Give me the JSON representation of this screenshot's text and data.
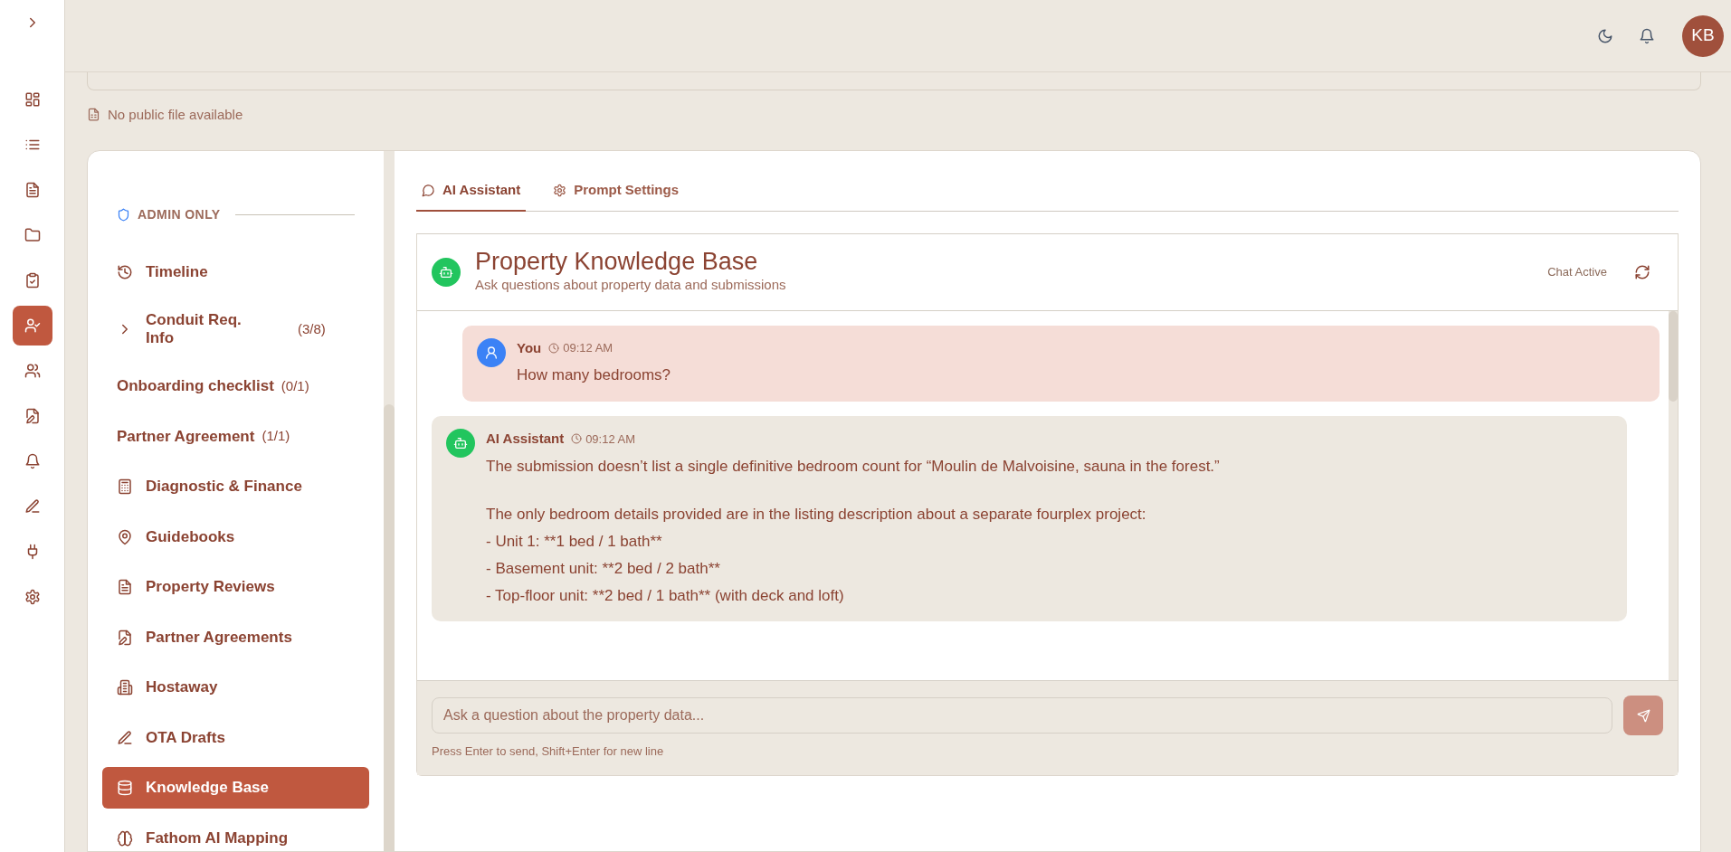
{
  "rail": {
    "items": [
      {
        "selected": false
      },
      {
        "selected": false
      },
      {
        "selected": false
      },
      {
        "selected": false
      },
      {
        "selected": false
      },
      {
        "selected": true
      },
      {
        "selected": false
      },
      {
        "selected": false
      },
      {
        "selected": false
      },
      {
        "selected": false
      },
      {
        "selected": false
      },
      {
        "selected": false
      }
    ]
  },
  "topbar": {
    "avatar": "KB"
  },
  "notice": "No public file available",
  "nav": {
    "section": "ADMIN ONLY",
    "items": [
      {
        "kind": "icon",
        "label": "Timeline",
        "selected": false
      },
      {
        "kind": "expander",
        "label": "Conduit Req. Info",
        "count": "(3/8)",
        "expanded": false,
        "selected": false
      },
      {
        "kind": "plain",
        "label": "Onboarding checklist",
        "count": "(0/1)",
        "selected": false
      },
      {
        "kind": "plain",
        "label": "Partner Agreement",
        "count": "(1/1)",
        "selected": false
      },
      {
        "kind": "icon",
        "label": "Diagnostic & Finance",
        "selected": false
      },
      {
        "kind": "icon",
        "label": "Guidebooks",
        "selected": false
      },
      {
        "kind": "icon",
        "label": "Property Reviews",
        "selected": false
      },
      {
        "kind": "icon",
        "label": "Partner Agreements",
        "selected": false
      },
      {
        "kind": "icon",
        "label": "Hostaway",
        "selected": false
      },
      {
        "kind": "icon",
        "label": "OTA Drafts",
        "selected": false
      },
      {
        "kind": "icon",
        "label": "Knowledge Base",
        "selected": true
      },
      {
        "kind": "icon",
        "label": "Fathom AI Mapping",
        "selected": false
      }
    ]
  },
  "tabs": [
    {
      "label": "AI Assistant",
      "selected": true
    },
    {
      "label": "Prompt Settings",
      "selected": false
    }
  ],
  "chat": {
    "title": "Property Knowledge Base",
    "subtitle": "Ask questions about property data and submissions",
    "status": "Chat Active",
    "messages": [
      {
        "kind": "user",
        "author": "You",
        "time": "09:12 AM",
        "paragraphs": [
          [
            "How many bedrooms?"
          ]
        ]
      },
      {
        "kind": "assistant",
        "author": "AI Assistant",
        "time": "09:12 AM",
        "paragraphs": [
          [
            "The submission doesn’t list a single definitive bedroom count for “Moulin de Malvoisine, sauna in the forest.”"
          ],
          [
            "The only bedroom details provided are in the listing description about a separate fourplex project:",
            "- Unit 1: **1 bed / 1 bath**",
            "- Basement unit: **2 bed / 2 bath**",
            "- Top-floor unit: **2 bed / 1 bath** (with deck and loft)"
          ]
        ]
      }
    ],
    "input": {
      "placeholder": "Ask a question about the property data..."
    },
    "hint": "Press Enter to send, Shift+Enter for new line"
  }
}
